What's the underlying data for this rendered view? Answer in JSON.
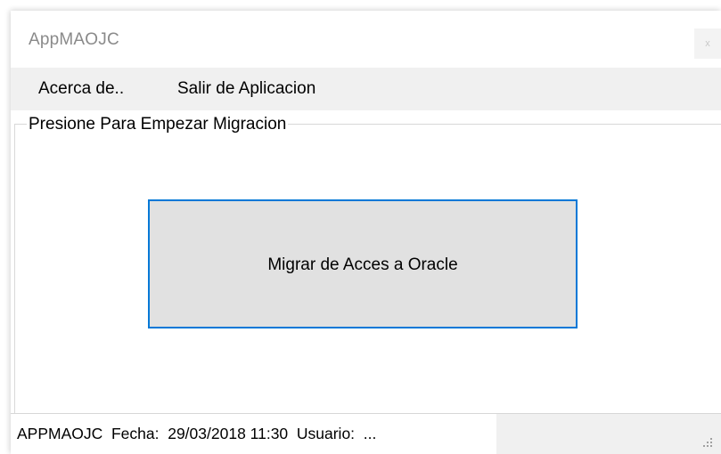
{
  "window": {
    "title": "AppMAOJC",
    "close_glyph": "x"
  },
  "menu": {
    "items": [
      {
        "label": "Acerca de.."
      },
      {
        "label": "Salir de Aplicacion"
      }
    ]
  },
  "main": {
    "group_caption": "Presione Para Empezar Migracion",
    "migrate_button_label": "Migrar de Acces a Oracle"
  },
  "statusbar": {
    "text": "APPMAOJC  Fecha:  29/03/2018 11:30  Usuario:  ..."
  },
  "colors": {
    "focus_border": "#0078d7",
    "button_face": "#e1e1e1",
    "menu_background": "#f0f0f0"
  }
}
